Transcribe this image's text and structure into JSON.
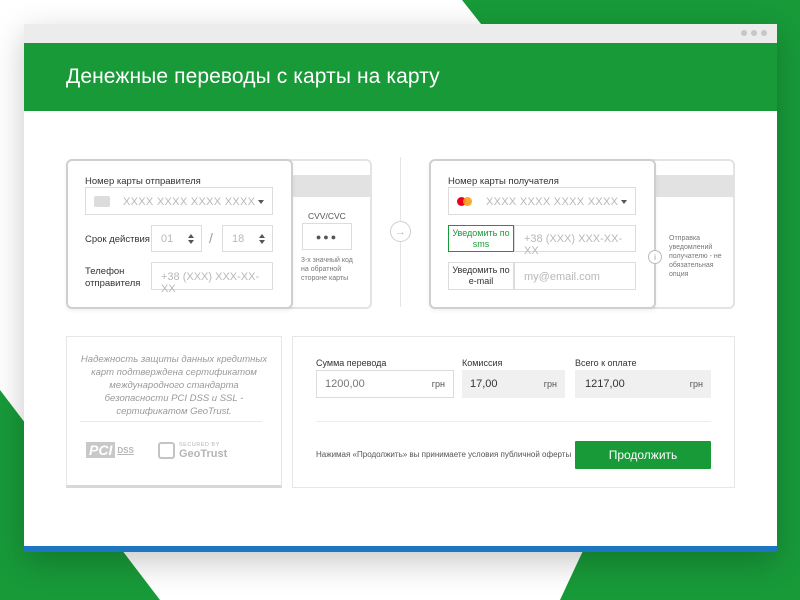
{
  "header": {
    "title": "Денежные переводы с карты на карту"
  },
  "sender": {
    "card_label": "Номер карты отправителя",
    "card_placeholder": "XXXX  XXXX  XXXX  XXXX",
    "expiry_label": "Срок действия",
    "month_value": "01",
    "year_value": "18",
    "separator": "/",
    "phone_label": "Телефон отправителя",
    "phone_placeholder": "+38 (XXX) XXX-XX-XX",
    "cvv_label": "CVV/CVC",
    "cvv_dots": "●●●",
    "cvv_hint": "3-х значный код на обратной стороне карты"
  },
  "arrow": {
    "icon": "arrow-right-icon"
  },
  "recipient": {
    "card_label": "Номер карты получателя",
    "card_placeholder": "XXXX  XXXX  XXXX  XXXX",
    "notify_sms_button": "Уведомить по sms",
    "phone_placeholder": "+38 (XXX) XXX-XX-XX",
    "notify_email_button": "Уведомить по e-mail",
    "email_placeholder": "my@email.com",
    "info_text": "Отправка уведомлений получателю - не обязательная опция"
  },
  "security": {
    "text": "Надежность защиты данных кредитных карт  подтверждена сертификатом международного стандарта безопасности PCI DSS и SSL - сертификатом GeoTrust.",
    "pci_logo": "PCI DSS",
    "geotrust_secured": "SECURED BY",
    "geotrust_name": "GeoTrust"
  },
  "payment": {
    "amount_label": "Сумма перевода",
    "amount_value": "1200,00",
    "commission_label": "Комиссия",
    "commission_value": "17,00",
    "total_label": "Всего к оплате",
    "total_value": "1217,00",
    "currency": "грн",
    "terms": "Нажимая «Продолжить» вы принимаете условия публичной оферты",
    "continue_button": "Продолжить"
  },
  "colors": {
    "brand": "#189a39",
    "accent_bar": "#1c76c0"
  }
}
